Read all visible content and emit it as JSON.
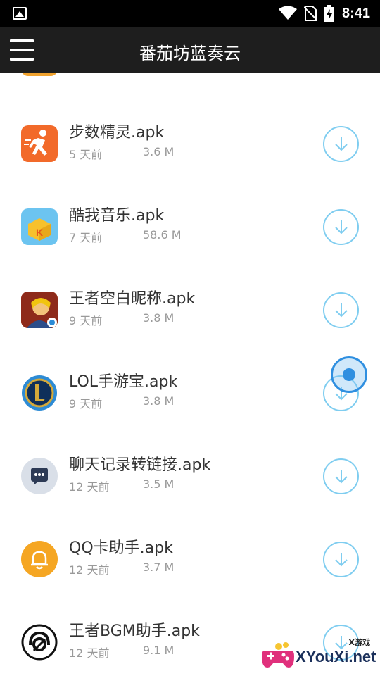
{
  "status_bar": {
    "time": "8:41",
    "icons": [
      "gallery-icon",
      "wifi-icon",
      "no-sim-icon",
      "battery-charging-icon"
    ]
  },
  "toolbar": {
    "title": "番茄坊蓝奏云",
    "menu_icon": "hamburger-menu-icon"
  },
  "files": [
    {
      "name": "步数精灵.apk",
      "age": "5 天前",
      "size": "3.6 M",
      "icon": "running-man-icon",
      "color": "#f26a2a"
    },
    {
      "name": "酷我音乐.apk",
      "age": "7 天前",
      "size": "58.6 M",
      "icon": "kuwo-music-icon",
      "color": "#3aa9e8"
    },
    {
      "name": "王者空白昵称.apk",
      "age": "9 天前",
      "size": "3.8 M",
      "icon": "honor-of-kings-icon",
      "color": "#c0392b"
    },
    {
      "name": "LOL手游宝.apk",
      "age": "9 天前",
      "size": "3.8 M",
      "icon": "lol-helper-icon",
      "color": "#2d8bd5"
    },
    {
      "name": "聊天记录转链接.apk",
      "age": "12 天前",
      "size": "3.5 M",
      "icon": "chat-bubble-icon",
      "color": "#c9d2e0"
    },
    {
      "name": "QQ卡助手.apk",
      "age": "12 天前",
      "size": "3.7 M",
      "icon": "bell-icon",
      "color": "#f5a623"
    },
    {
      "name": "王者BGM助手.apk",
      "age": "12 天前",
      "size": "9.1 M",
      "icon": "headphone-disc-icon",
      "color": "#111111"
    }
  ],
  "download_icon": "download-arrow-icon",
  "accent_color": "#7fcdf0",
  "watermark": {
    "small": "X游戏",
    "text": "XYouXi.net"
  }
}
